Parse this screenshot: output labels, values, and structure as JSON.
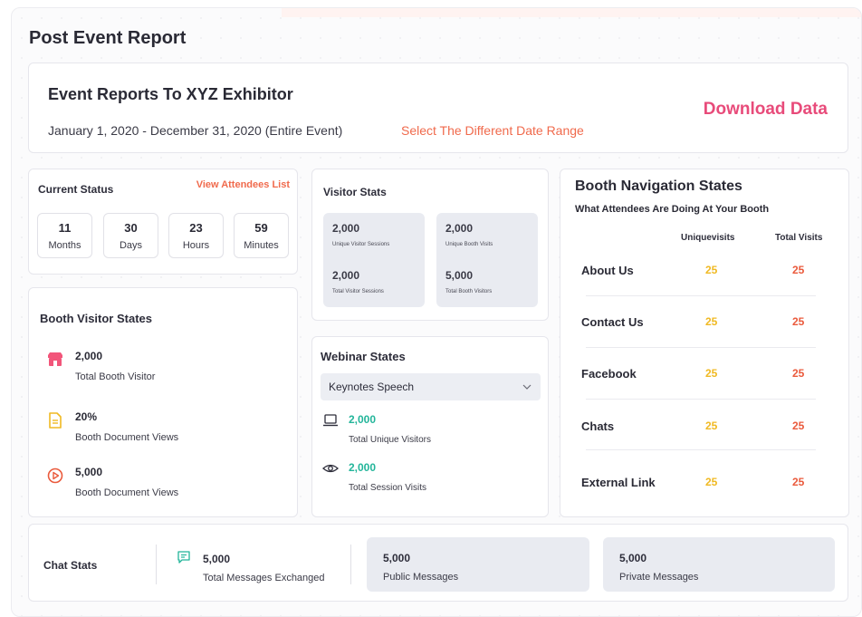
{
  "page": {
    "title": "Post Event Report"
  },
  "header": {
    "title": "Event Reports To XYZ Exhibitor",
    "date_range": "January 1, 2020 - December 31, 2020 (Entire Event)",
    "change_range_link": "Select The Different Date Range",
    "download_button": "Download Data"
  },
  "current_status": {
    "label": "Current Status",
    "attendees_link": "View Attendees List",
    "timers": [
      {
        "value": "11",
        "unit": "Months"
      },
      {
        "value": "30",
        "unit": "Days"
      },
      {
        "value": "23",
        "unit": "Hours"
      },
      {
        "value": "59",
        "unit": "Minutes"
      }
    ]
  },
  "booth_visitor_states": {
    "label": "Booth Visitor States",
    "items": [
      {
        "icon": "store-icon",
        "value": "2,000",
        "desc": "Total Booth Visitor"
      },
      {
        "icon": "document-icon",
        "value": "20%",
        "desc": "Booth Document Views"
      },
      {
        "icon": "play-icon",
        "value": "5,000",
        "desc": "Booth Document Views"
      }
    ]
  },
  "visitor_stats": {
    "label": "Visitor Stats",
    "boxes": [
      {
        "v1": "2,000",
        "d1": "Unique Visitor Sessions",
        "v2": "2,000",
        "d2": "Total Visitor Sessions"
      },
      {
        "v1": "2,000",
        "d1": "Unique Booth Visits",
        "v2": "5,000",
        "d2": "Total Booth Visitors"
      }
    ]
  },
  "webinar_states": {
    "label": "Webinar States",
    "selected": "Keynotes Speech",
    "items": [
      {
        "icon": "laptop-icon",
        "value": "2,000",
        "desc": "Total Unique Visitors"
      },
      {
        "icon": "eye-icon",
        "value": "2,000",
        "desc": "Total Session Visits"
      }
    ]
  },
  "booth_navigation": {
    "label": "Booth Navigation States",
    "subtitle": "What Attendees Are Doing At Your Booth",
    "col_unique": "Uniquevisits",
    "col_total": "Total Visits",
    "rows": [
      {
        "name": "About Us",
        "unique": "25",
        "total": "25"
      },
      {
        "name": "Contact Us",
        "unique": "25",
        "total": "25"
      },
      {
        "name": "Facebook",
        "unique": "25",
        "total": "25"
      },
      {
        "name": "Chats",
        "unique": "25",
        "total": "25"
      },
      {
        "name": "External Link",
        "unique": "25",
        "total": "25"
      }
    ]
  },
  "chat_stats": {
    "label": "Chat Stats",
    "messages": {
      "value": "5,000",
      "desc": "Total Messages Exchanged"
    },
    "public": {
      "value": "5,000",
      "desc": "Public Messages"
    },
    "private": {
      "value": "5,000",
      "desc": "Private Messages"
    }
  },
  "colors": {
    "accent_orange": "#f06a4c",
    "download_pink": "#e84b7a",
    "green": "#23b59a",
    "yellow": "#f0b922",
    "red_value": "#ea5a3c"
  }
}
